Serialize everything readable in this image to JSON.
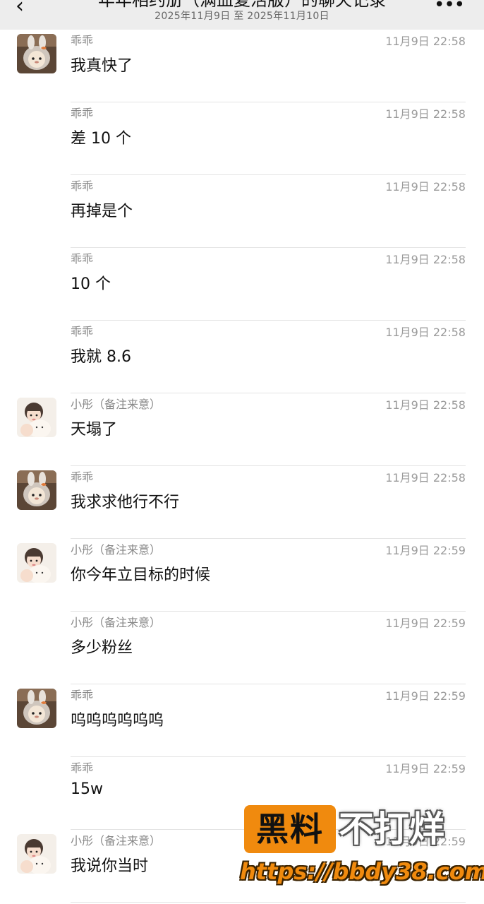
{
  "header": {
    "title": "年年相约册（满血复活版）的聊天记录",
    "subtitle": "2025年11月9日 至 2025年11月10日",
    "back_icon": "‹",
    "more_icon": "•••"
  },
  "messages": [
    {
      "sender": "乖乖",
      "time": "11月9日 22:58",
      "text": "我真快了",
      "avatar": "guaiguai"
    },
    {
      "sender": "乖乖",
      "time": "11月9日 22:58",
      "text": "差 10 个",
      "avatar": ""
    },
    {
      "sender": "乖乖",
      "time": "11月9日 22:58",
      "text": "再掉是个",
      "avatar": ""
    },
    {
      "sender": "乖乖",
      "time": "11月9日 22:58",
      "text": "10 个",
      "avatar": ""
    },
    {
      "sender": "乖乖",
      "time": "11月9日 22:58",
      "text": "我就 8.6",
      "avatar": ""
    },
    {
      "sender": "小彤（备注来意）",
      "time": "11月9日 22:58",
      "text": "天塌了",
      "avatar": "xiaotong"
    },
    {
      "sender": "乖乖",
      "time": "11月9日 22:58",
      "text": "我求求他行不行",
      "avatar": "guaiguai"
    },
    {
      "sender": "小彤（备注来意）",
      "time": "11月9日 22:59",
      "text": "你今年立目标的时候",
      "avatar": "xiaotong"
    },
    {
      "sender": "小彤（备注来意）",
      "time": "11月9日 22:59",
      "text": "多少粉丝",
      "avatar": ""
    },
    {
      "sender": "乖乖",
      "time": "11月9日 22:59",
      "text": "呜呜呜呜呜呜",
      "avatar": "guaiguai"
    },
    {
      "sender": "乖乖",
      "time": "11月9日 22:59",
      "text": "15w",
      "avatar": ""
    },
    {
      "sender": "小彤（备注来意）",
      "time": "11月9日 22:59",
      "text": "我说你当时",
      "avatar": "xiaotong"
    }
  ],
  "watermark": {
    "black_text": "黑料",
    "white_text": "不打烊",
    "url": "https://bbdy38.com"
  },
  "colors": {
    "header_bg": "#ededed",
    "divider": "#e4e4e4",
    "watermark_orange": "#f08a0e"
  }
}
